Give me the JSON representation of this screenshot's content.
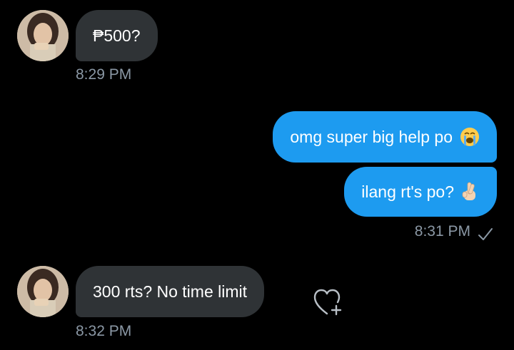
{
  "messages": [
    {
      "direction": "incoming",
      "text": "₱500?",
      "time": "8:29 PM"
    },
    {
      "direction": "outgoing",
      "text": "omg super big help po",
      "emoji": "loudly-crying-face-icon"
    },
    {
      "direction": "outgoing",
      "text": "ilang rt's po?",
      "emoji": "crossed-fingers-icon",
      "time": "8:31 PM",
      "status": "sent-check-icon"
    },
    {
      "direction": "incoming",
      "text": "300 rts? No time limit",
      "time": "8:32 PM",
      "reaction_button": "add-reaction-heart-icon"
    }
  ],
  "colors": {
    "background": "#000000",
    "incoming_bubble": "#2f3336",
    "outgoing_bubble": "#1d9bf0",
    "timestamp": "#8b98a5",
    "text": "#ffffff"
  }
}
